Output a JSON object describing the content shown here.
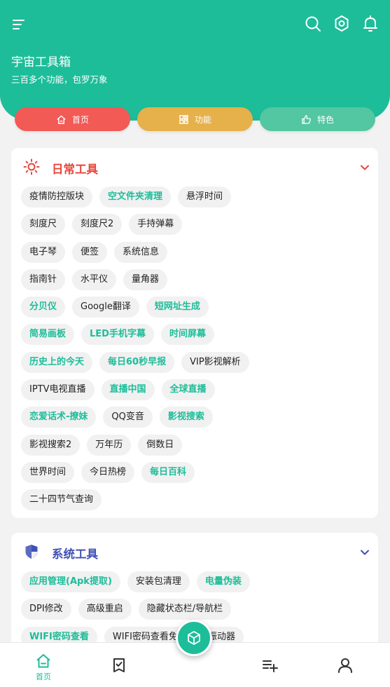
{
  "app": {
    "title": "宇宙工具箱",
    "subtitle": "三百多个功能，包罗万象"
  },
  "nav_pills": [
    {
      "label": "首页",
      "icon": "home-icon",
      "color": "#f25a56"
    },
    {
      "label": "功能",
      "icon": "grid-icon",
      "color": "#e6b04a"
    },
    {
      "label": "特色",
      "icon": "thumbs-up-icon",
      "color": "#52c7a1"
    }
  ],
  "daily": {
    "title": "日常工具",
    "title_color": "#e8453c",
    "rows": [
      [
        {
          "label": "疫情防控版块",
          "hl": false
        },
        {
          "label": "空文件夹清理",
          "hl": true
        },
        {
          "label": "悬浮时间",
          "hl": false
        }
      ],
      [
        {
          "label": "刻度尺",
          "hl": false
        },
        {
          "label": "刻度尺2",
          "hl": false
        },
        {
          "label": "手持弹幕",
          "hl": false
        }
      ],
      [
        {
          "label": "电子琴",
          "hl": false
        },
        {
          "label": "便签",
          "hl": false
        },
        {
          "label": "系统信息",
          "hl": false
        }
      ],
      [
        {
          "label": "指南针",
          "hl": false
        },
        {
          "label": "水平仪",
          "hl": false
        },
        {
          "label": "量角器",
          "hl": false
        }
      ],
      [
        {
          "label": "分贝仪",
          "hl": true
        },
        {
          "label": "Google翻译",
          "hl": false
        },
        {
          "label": "短网址生成",
          "hl": true
        }
      ],
      [
        {
          "label": "简易画板",
          "hl": true
        },
        {
          "label": "LED手机字幕",
          "hl": true
        },
        {
          "label": "时间屏幕",
          "hl": true
        }
      ],
      [
        {
          "label": "历史上的今天",
          "hl": true
        },
        {
          "label": "每日60秒早报",
          "hl": true
        },
        {
          "label": "VIP影视解析",
          "hl": false
        }
      ],
      [
        {
          "label": "IPTV电视直播",
          "hl": false
        },
        {
          "label": "直播中国",
          "hl": true
        },
        {
          "label": "全球直播",
          "hl": true
        }
      ],
      [
        {
          "label": "恋爱话术-撩妹",
          "hl": true
        },
        {
          "label": "QQ变音",
          "hl": false
        },
        {
          "label": "影视搜索",
          "hl": true
        }
      ],
      [
        {
          "label": "影视搜索2",
          "hl": false
        },
        {
          "label": "万年历",
          "hl": false
        },
        {
          "label": "倒数日",
          "hl": false
        }
      ],
      [
        {
          "label": "世界时间",
          "hl": false
        },
        {
          "label": "今日热榜",
          "hl": false
        },
        {
          "label": "每日百科",
          "hl": true
        }
      ],
      [
        {
          "label": "二十四节气查询",
          "hl": false
        }
      ]
    ]
  },
  "system": {
    "title": "系统工具",
    "title_color": "#3f51b5",
    "rows": [
      [
        {
          "label": "应用管理(Apk提取)",
          "hl": true
        },
        {
          "label": "安装包清理",
          "hl": false
        },
        {
          "label": "电量伪装",
          "hl": true
        }
      ],
      [
        {
          "label": "DPI修改",
          "hl": false
        },
        {
          "label": "高级重启",
          "hl": false
        },
        {
          "label": "隐藏状态栏/导航栏",
          "hl": false
        }
      ],
      [
        {
          "label": "WIFI密码查看",
          "hl": true
        },
        {
          "label": "WIFI密码查看免R",
          "hl": false
        },
        {
          "label": "振动器",
          "hl": false
        }
      ]
    ]
  },
  "bottom_nav": {
    "home_label": "首页"
  },
  "colors": {
    "accent": "#1dbd9a",
    "chip_bg": "#f1f1f1"
  }
}
